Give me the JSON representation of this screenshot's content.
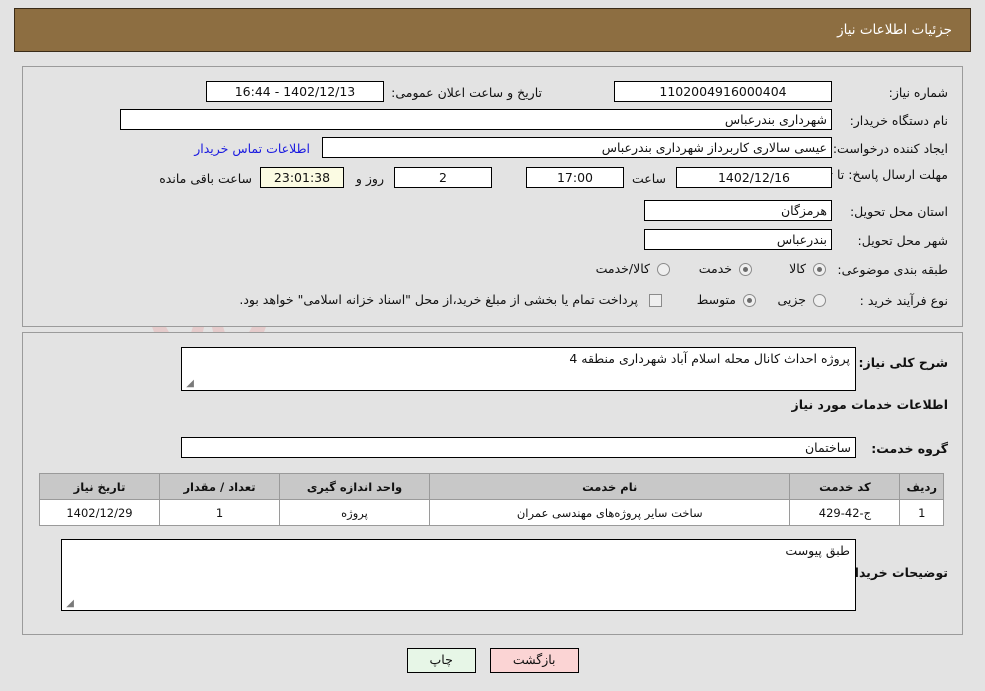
{
  "header": {
    "title": "جزئیات اطلاعات نیاز"
  },
  "watermark": {
    "text": "ArtaTender.net",
    "shield_color": "#e8b9b9"
  },
  "form": {
    "need_number": {
      "label": "شماره نیاز:",
      "value": "1102004916000404"
    },
    "public_announce": {
      "label": "تاریخ و ساعت اعلان عمومی:",
      "value": "16:44 - 1402/12/13"
    },
    "buyer_org": {
      "label": "نام دستگاه خریدار:",
      "value": "شهرداری بندرعباس"
    },
    "requester": {
      "label": "ایجاد کننده درخواست:",
      "value": "عیسی سالاری کاربرداز شهرداری بندرعباس"
    },
    "buyer_contact_link": "اطلاعات تماس خریدار",
    "deadline": {
      "label": "مهلت ارسال پاسخ: تا تاریخ:",
      "date": "1402/12/16",
      "hour_label": "ساعت",
      "time": "17:00",
      "days": "2",
      "days_label": "روز و",
      "countdown": "23:01:38",
      "countdown_label": "ساعت باقی مانده"
    },
    "province": {
      "label": "استان محل تحویل:",
      "value": "هرمزگان"
    },
    "city": {
      "label": "شهر محل تحویل:",
      "value": "بندرعباس"
    },
    "category": {
      "label": "طبقه بندی موضوعی:",
      "options": [
        "کالا",
        "خدمت",
        "کالا/خدمت"
      ],
      "selected": "خدمت"
    },
    "process_type": {
      "label": "نوع فرآیند خرید :",
      "options": [
        "جزیی",
        "متوسط"
      ],
      "selected": "متوسط"
    },
    "treasury_note": {
      "text": "پرداخت تمام یا بخشی از مبلغ خرید،از محل \"اسناد خزانه اسلامی\" خواهد بود.",
      "checked": false
    }
  },
  "need_description": {
    "label": "شرح کلی نیاز:",
    "value": "پروژه احداث کانال محله اسلام آباد شهرداری منطقه 4"
  },
  "services_section": {
    "heading": "اطلاعات خدمات مورد نیاز",
    "service_group": {
      "label": "گروه خدمت:",
      "value": "ساختمان"
    }
  },
  "items_table": {
    "columns": [
      "ردیف",
      "کد خدمت",
      "نام خدمت",
      "واحد اندازه گیری",
      "تعداد / مقدار",
      "تاریخ نیاز"
    ],
    "rows": [
      {
        "row": "1",
        "code": "ج-42-429",
        "name": "ساخت سایر پروژه‌های مهندسی عمران",
        "unit": "پروژه",
        "qty": "1",
        "date": "1402/12/29"
      }
    ]
  },
  "buyer_comments": {
    "label": "توضیحات خریدار:",
    "value": "طبق پیوست"
  },
  "buttons": {
    "print": "چاپ",
    "back": "بازگشت"
  }
}
